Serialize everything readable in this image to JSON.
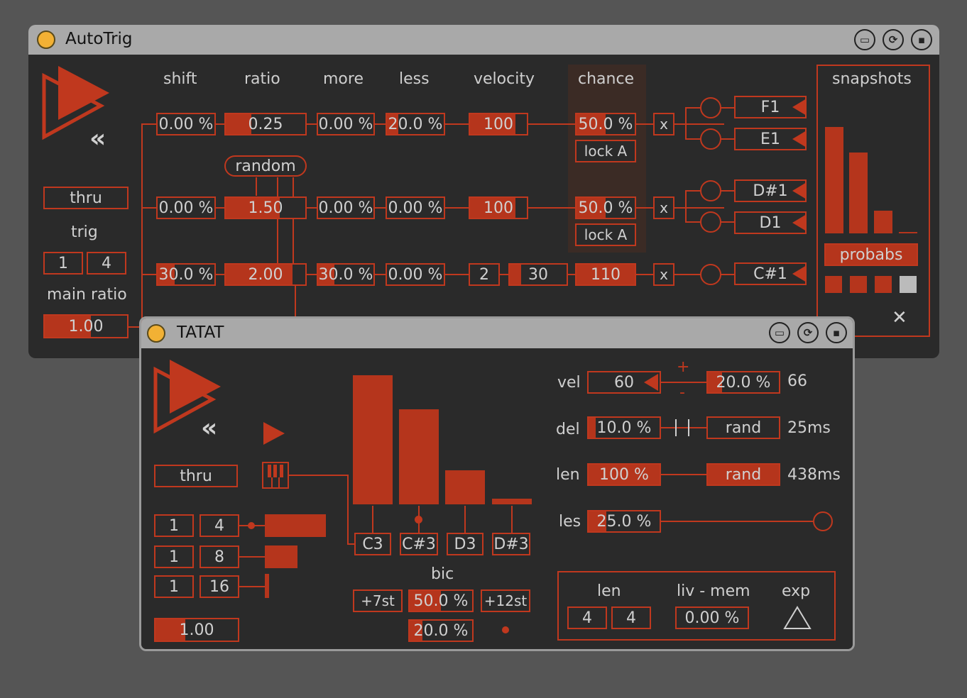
{
  "autotrig": {
    "title": "AutoTrig",
    "thru_label": "thru",
    "trig_label": "trig",
    "trig_values": [
      "1",
      "4"
    ],
    "main_ratio_label": "main ratio",
    "main_ratio_value": "1.00",
    "col_shift": "shift",
    "col_ratio": "ratio",
    "col_more": "more",
    "col_less": "less",
    "col_velocity": "velocity",
    "col_chance": "chance",
    "random_label": "random",
    "lock_label": "lock A",
    "x_label": "x",
    "rows": [
      {
        "shift": "0.00 %",
        "ratio": "0.25",
        "more": "0.00 %",
        "less": "20.0 %",
        "velocity": "100",
        "chance": "50.0 %"
      },
      {
        "shift": "0.00 %",
        "ratio": "1.50",
        "more": "0.00 %",
        "less": "0.00 %",
        "velocity": "100",
        "chance": "50.0 %"
      },
      {
        "shift": "30.0 %",
        "ratio": "2.00",
        "more": "30.0 %",
        "less": "0.00 %",
        "vel_a": "2",
        "vel_b": "30",
        "chance": "110"
      }
    ],
    "notes": [
      "F1",
      "E1",
      "D#1",
      "D1",
      "C#1"
    ],
    "snapshots_label": "snapshots",
    "probabs_label": "probabs",
    "close_glyph": "✕"
  },
  "tatat": {
    "title": "TATAT",
    "thru_label": "thru",
    "rates": [
      [
        "1",
        "4"
      ],
      [
        "1",
        "8"
      ],
      [
        "1",
        "16"
      ]
    ],
    "ratio_value": "1.00",
    "notes": [
      "C3",
      "C#3",
      "D3",
      "D#3"
    ],
    "bic_label": "bic",
    "transpose_left": "+7st",
    "transpose_center": "50.0 %",
    "transpose_right": "+12st",
    "bic_amount": "20.0 %",
    "vel_label": "vel",
    "vel_value": "60",
    "vel_pct": "20.0 %",
    "vel_result": "66",
    "plus": "+",
    "minus": "-",
    "del_label": "del",
    "del_value": "10.0 %",
    "del_rand": "rand",
    "del_result": "25ms",
    "len_label": "len",
    "len_value": "100 %",
    "len_rand": "rand",
    "len_result": "438ms",
    "les_label": "les",
    "les_value": "25.0 %",
    "mem_len_label": "len",
    "mem_len_values": [
      "4",
      "4"
    ],
    "liv_mem_label": "liv - mem",
    "liv_mem_value": "0.00 %",
    "exp_label": "exp"
  },
  "colors": {
    "accent": "#b5351c",
    "panel": "#2a2a2a",
    "titlebar": "#a9a9a9",
    "background": "#555555",
    "title_dot": "#f2b134"
  }
}
